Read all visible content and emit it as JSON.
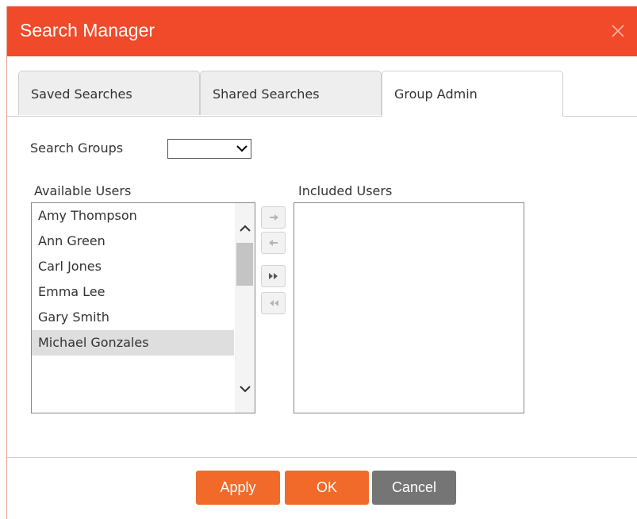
{
  "dialog": {
    "title": "Search Manager",
    "colors": {
      "titlebar": "#f04a2a",
      "primary_button": "#f26a2a",
      "secondary_button": "#757575"
    }
  },
  "tabs": [
    {
      "label": "Saved Searches",
      "active": false
    },
    {
      "label": "Shared Searches",
      "active": false
    },
    {
      "label": "Group Admin",
      "active": true
    }
  ],
  "group_admin": {
    "search_groups_label": "Search Groups",
    "search_groups_value": "",
    "available_users_label": "Available Users",
    "included_users_label": "Included Users",
    "available_users": [
      {
        "name": "Amy Thompson",
        "selected": false
      },
      {
        "name": "Ann Green",
        "selected": false
      },
      {
        "name": "Carl Jones",
        "selected": false
      },
      {
        "name": "Emma Lee",
        "selected": false
      },
      {
        "name": "Gary Smith",
        "selected": false
      },
      {
        "name": "Michael Gonzales",
        "selected": true
      }
    ],
    "included_users": [],
    "move_buttons": [
      {
        "icon": "arrow-right-icon",
        "name": "add-selected-button"
      },
      {
        "icon": "arrow-left-icon",
        "name": "remove-selected-button"
      },
      {
        "icon": "double-right-icon",
        "name": "add-all-button"
      },
      {
        "icon": "double-left-icon",
        "name": "remove-all-button"
      }
    ]
  },
  "footer": {
    "apply_label": "Apply",
    "ok_label": "OK",
    "cancel_label": "Cancel"
  }
}
